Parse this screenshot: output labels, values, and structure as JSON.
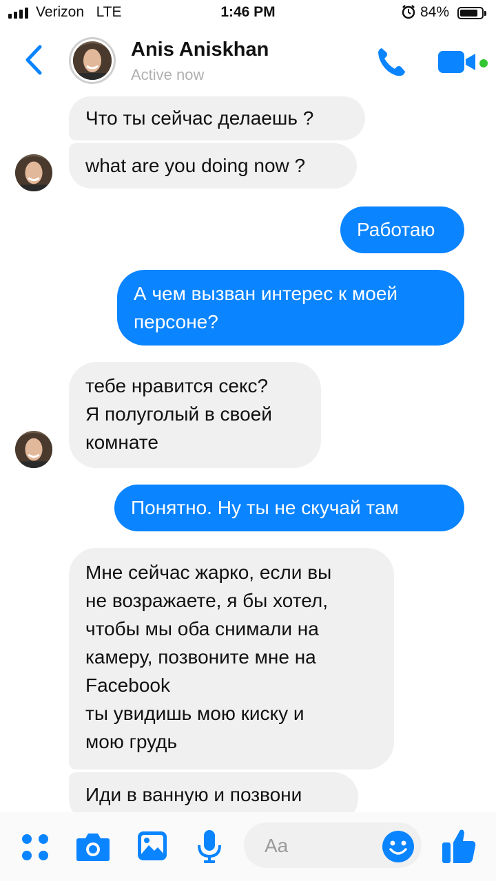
{
  "status_bar": {
    "carrier": "Verizon",
    "network": "LTE",
    "time": "1:46 PM",
    "battery_percent": "84%",
    "battery_level": 0.84
  },
  "header": {
    "contact_name": "Anis Aniskhan",
    "contact_status": "Active now"
  },
  "messages": [
    {
      "direction": "incoming",
      "text": "Что ты сейчас делаешь ?"
    },
    {
      "direction": "incoming",
      "text": "what are you doing now ?"
    },
    {
      "direction": "outgoing",
      "text": "Работаю"
    },
    {
      "direction": "outgoing",
      "text": "А чем вызван интерес к моей\nперсоне?"
    },
    {
      "direction": "incoming",
      "text": "тебе нравится секс?\nЯ полуголый в своей\nкомнате"
    },
    {
      "direction": "outgoing",
      "text": "Понятно. Ну ты не скучай там"
    },
    {
      "direction": "incoming",
      "text": "Мне сейчас жарко, если вы\nне возражаете, я бы хотел,\nчтобы мы оба снимали на\nкамеру, позвоните мне на\nFacebook\nты увидишь мою киску и\nмою грудь"
    },
    {
      "direction": "incoming",
      "text": "Иди в ванную и позвони"
    }
  ],
  "composer": {
    "placeholder": "Aa",
    "icons": [
      "apps-icon",
      "camera-icon",
      "gallery-icon",
      "microphone-icon",
      "emoji-icon",
      "thumbs-up-icon"
    ]
  },
  "colors": {
    "accent": "#0a84ff",
    "incoming_bubble": "#f0f0f0",
    "online": "#31c631"
  }
}
